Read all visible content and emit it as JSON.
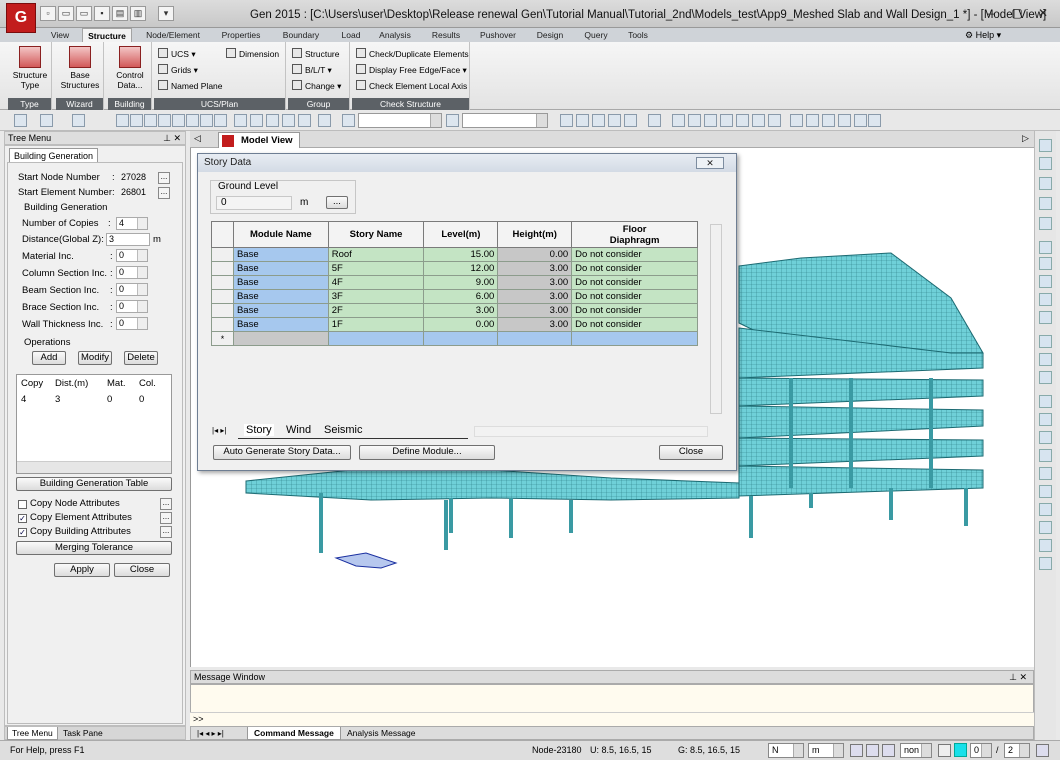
{
  "window": {
    "title": "Gen 2015 : [C:\\Users\\user\\Desktop\\Release renewal Gen\\Tutorial Manual\\Tutorial_2nd\\Models_test\\App9_Meshed Slab and Wall Design_1 *] - [Model View]",
    "app_icon_label": "G"
  },
  "ribbon": {
    "tabs": [
      "View",
      "Structure",
      "Node/Element",
      "Properties",
      "Boundary",
      "Load",
      "Analysis",
      "Results",
      "Pushover",
      "Design",
      "Query",
      "Tools"
    ],
    "active_tab": "Structure",
    "help_label": "Help",
    "groups": {
      "type": {
        "label": "Type",
        "button": "Structure\nType"
      },
      "wizard": {
        "label": "Wizard",
        "button": "Base\nStructures"
      },
      "building": {
        "label": "Building",
        "button": "Control\nData..."
      },
      "ucs_plan": {
        "label": "UCS/Plan",
        "items": [
          "UCS",
          "Grids",
          "Named Plane",
          "Dimension"
        ]
      },
      "group": {
        "label": "Group",
        "items": [
          "Structure",
          "B/L/T",
          "Change"
        ]
      },
      "check_structure": {
        "label": "Check Structure",
        "items": [
          "Check/Duplicate Elements",
          "Display Free Edge/Face",
          "Check Element Local Axis"
        ]
      }
    }
  },
  "tree_menu": {
    "header": "Tree Menu",
    "tab": "Building Generation",
    "start_node_label": "Start Node Number",
    "start_node_value": "27028",
    "start_element_label": "Start Element Number",
    "start_element_value": "26801",
    "building_generation_label": "Building Generation",
    "copies_label": "Number of Copies",
    "copies_value": "4",
    "distance_label": "Distance(Global Z):",
    "distance_value": "3",
    "distance_unit": "m",
    "material_label": "Material Inc.",
    "material_value": "0",
    "column_label": "Column Section Inc.",
    "column_value": "0",
    "beam_label": "Beam Section Inc.",
    "beam_value": "0",
    "brace_label": "Brace Section Inc.",
    "brace_value": "0",
    "wall_label": "Wall Thickness Inc.",
    "wall_value": "0",
    "operations_label": "Operations",
    "add": "Add",
    "modify": "Modify",
    "delete": "Delete",
    "list_headers": [
      "Copy",
      "Dist.(m)",
      "Mat.",
      "Col."
    ],
    "list_rows": [
      [
        "4",
        "3",
        "0",
        "0"
      ]
    ],
    "table_button": "Building Generation Table",
    "copy_node": "Copy Node Attributes",
    "copy_element": "Copy Element Attributes",
    "copy_building": "Copy Building Attributes",
    "merging": "Merging Tolerance",
    "apply": "Apply",
    "close": "Close",
    "bottom_tabs": [
      "Tree Menu",
      "Task Pane"
    ]
  },
  "model_view": {
    "tab": "Model View"
  },
  "dialog": {
    "title": "Story Data",
    "ground_level_label": "Ground Level",
    "ground_level_value": "0",
    "ground_level_unit": "m",
    "dots": "...",
    "columns": [
      "Module Name",
      "Story Name",
      "Level(m)",
      "Height(m)",
      "Floor\nDiaphragm"
    ],
    "rows": [
      [
        "Base",
        "Roof",
        "15.00",
        "0.00",
        "Do not consider"
      ],
      [
        "Base",
        "5F",
        "12.00",
        "3.00",
        "Do not consider"
      ],
      [
        "Base",
        "4F",
        "9.00",
        "3.00",
        "Do not consider"
      ],
      [
        "Base",
        "3F",
        "6.00",
        "3.00",
        "Do not consider"
      ],
      [
        "Base",
        "2F",
        "3.00",
        "3.00",
        "Do not consider"
      ],
      [
        "Base",
        "1F",
        "0.00",
        "3.00",
        "Do not consider"
      ]
    ],
    "new_row_marker": "*",
    "tabs": [
      "Story",
      "Wind",
      "Seismic"
    ],
    "auto_generate": "Auto Generate Story Data...",
    "define_module": "Define Module...",
    "close": "Close"
  },
  "message_window": {
    "header": "Message Window",
    "prompt": ">>",
    "tabs": [
      "Command Message",
      "Analysis Message"
    ]
  },
  "status_bar": {
    "help_text": "For Help, press F1",
    "node": "Node-23180",
    "u_coords": "U: 8.5, 16.5, 15",
    "g_coords": "G: 8.5, 16.5, 15",
    "force_unit": "N",
    "length_unit": "m",
    "filter": "non",
    "page_value": "0",
    "page_total": "2",
    "colors": {
      "accent": "#c21c1c",
      "structure": "#6fd0d8"
    }
  }
}
